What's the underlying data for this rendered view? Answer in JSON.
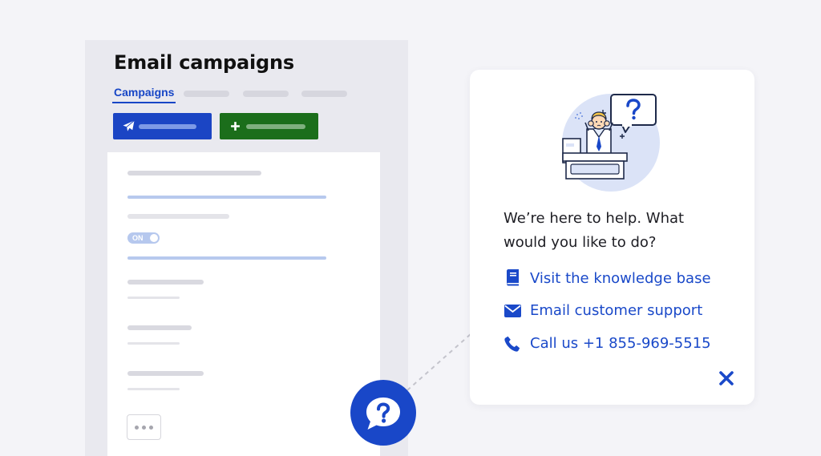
{
  "app": {
    "title": "Email campaigns",
    "tabs": [
      {
        "label": "Campaigns"
      }
    ],
    "toggle": {
      "label": "ON"
    }
  },
  "help_popup": {
    "message": "We’re here to help. What would you like to do?",
    "links": [
      {
        "label": "Visit the knowledge base",
        "icon": "book-icon"
      },
      {
        "label": "Email customer support",
        "icon": "envelope-icon"
      },
      {
        "label": "Call us +1 855-969-5515",
        "icon": "phone-icon"
      }
    ],
    "close_icon": "close-icon"
  },
  "colors": {
    "brand_blue": "#1947c8",
    "link_blue": "#1a49c9",
    "add_green": "#1b6e1b"
  }
}
